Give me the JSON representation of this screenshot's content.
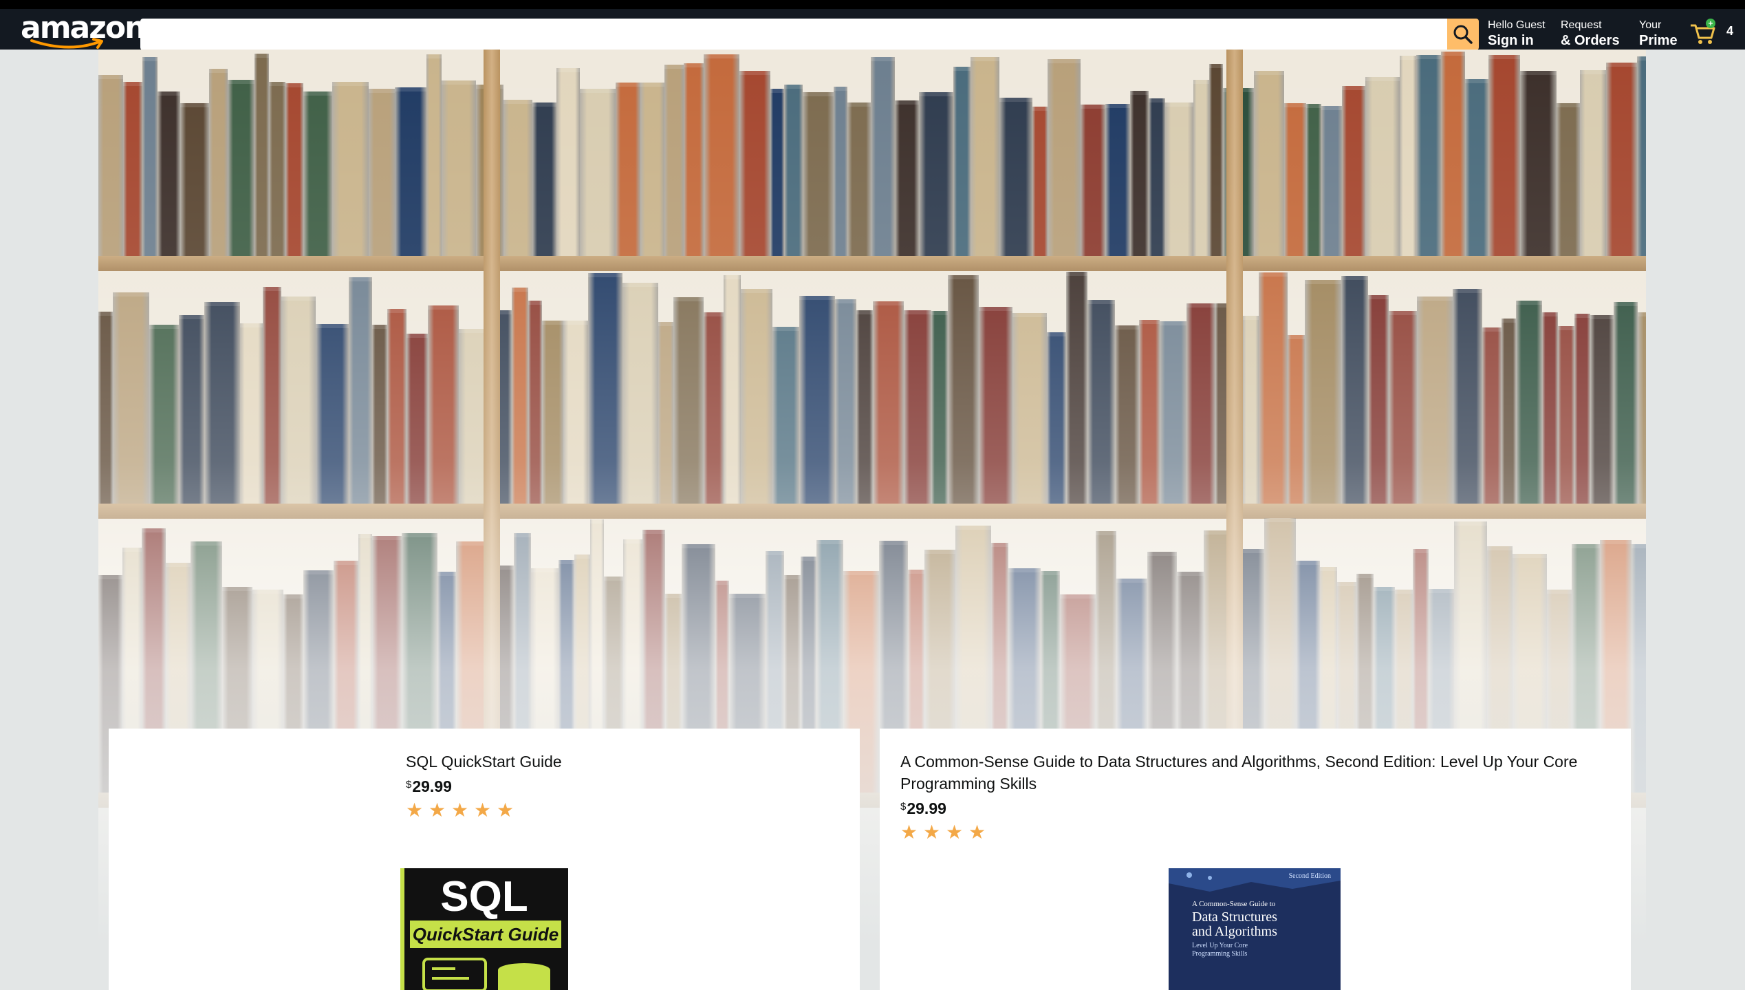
{
  "header": {
    "logo_text": "amazon",
    "search_placeholder": "",
    "greeting": "Hello Guest",
    "sign_in": "Sign in",
    "request": "Request",
    "orders": "& Orders",
    "your": "Your",
    "prime": "Prime",
    "cart_count": "4",
    "colors": {
      "bar": "#131921",
      "search_button": "#febd69"
    }
  },
  "products": [
    {
      "title": "SQL QuickStart Guide",
      "currency": "$",
      "price": "29.99",
      "rating": 5,
      "cover": {
        "line1": "SQL",
        "line2": "QuickStart Guide"
      }
    },
    {
      "title": "A Common-Sense Guide to Data Structures and Algorithms, Second Edition: Level Up Your Core Programming Skills",
      "currency": "$",
      "price": "29.99",
      "rating": 4,
      "cover": {
        "edition": "Second Edition",
        "small_title": "A Common-Sense Guide to",
        "big_title_1": "Data Structures",
        "big_title_2": "and Algorithms",
        "subtitle_1": "Level Up Your Core",
        "subtitle_2": "Programming Skills"
      }
    }
  ]
}
